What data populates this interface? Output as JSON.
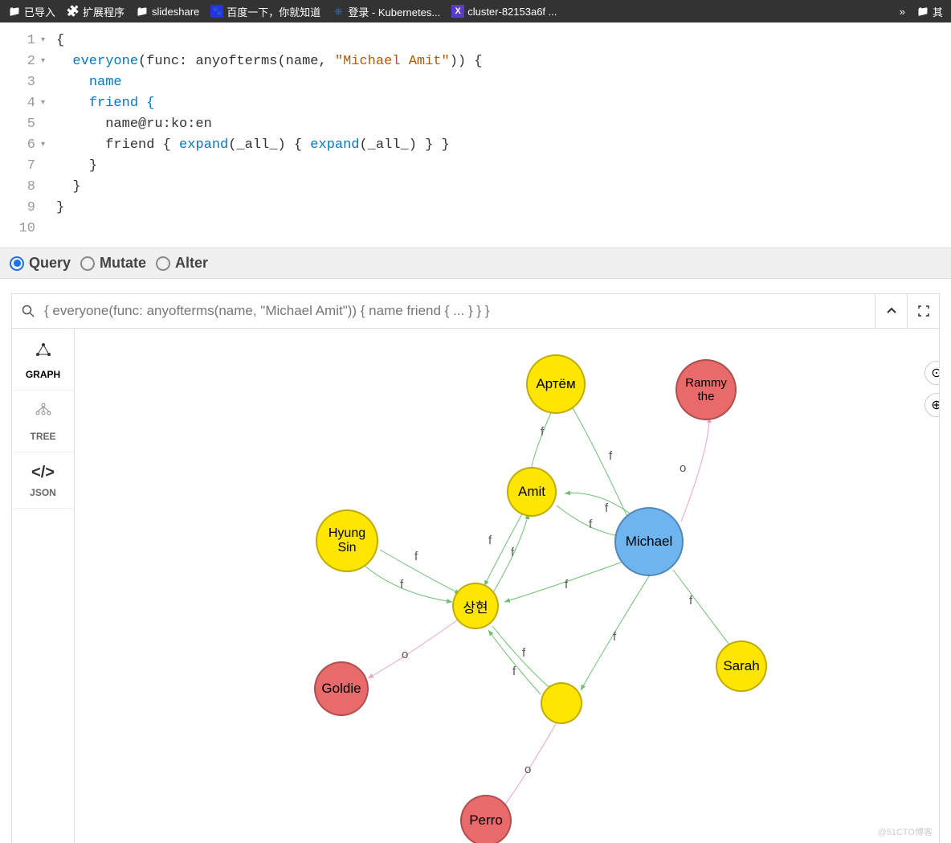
{
  "bookmarks": {
    "b0": "已导入",
    "b1": "扩展程序",
    "b2": "slideshare",
    "b3": "百度一下，你就知道",
    "b4": "登录 - Kubernetes...",
    "b5": "cluster-82153a6f ...",
    "overflow": "»",
    "b6": "其"
  },
  "editor": {
    "lines": [
      "1",
      "2",
      "3",
      "4",
      "5",
      "6",
      "7",
      "8",
      "9",
      "10"
    ],
    "l1": "{",
    "l2a": "everyone",
    "l2b": "(func: anyofterms(name, ",
    "l2c": "\"Michael Amit\"",
    "l2d": ")) {",
    "l3": "name",
    "l4": "friend {",
    "l5": "name@ru:ko:en",
    "l6a": "friend { ",
    "l6b": "expand",
    "l6c": "(_all_) { ",
    "l6d": "expand",
    "l6e": "(_all_) } }",
    "l7": "}",
    "l8": "}",
    "l9": "}"
  },
  "modes": {
    "query": "Query",
    "mutate": "Mutate",
    "alter": "Alter"
  },
  "querybar": "{ everyone(func: anyofterms(name, \"Michael Amit\")) { name friend { ... } } }",
  "sidebar": {
    "graph": "GRAPH",
    "tree": "TREE",
    "json": "JSON"
  },
  "nodes": {
    "artyom": "Артём",
    "rammy": "Rammy\nthe",
    "amit": "Amit",
    "hyung": "Hyung\nSin",
    "michael": "Michael",
    "sanghyeon": "상현",
    "goldie": "Goldie",
    "sarah": "Sarah",
    "perro": "Perro",
    "blank": ""
  },
  "edge": {
    "f": "f",
    "o": "o"
  },
  "watermark": "@51CTO博客"
}
